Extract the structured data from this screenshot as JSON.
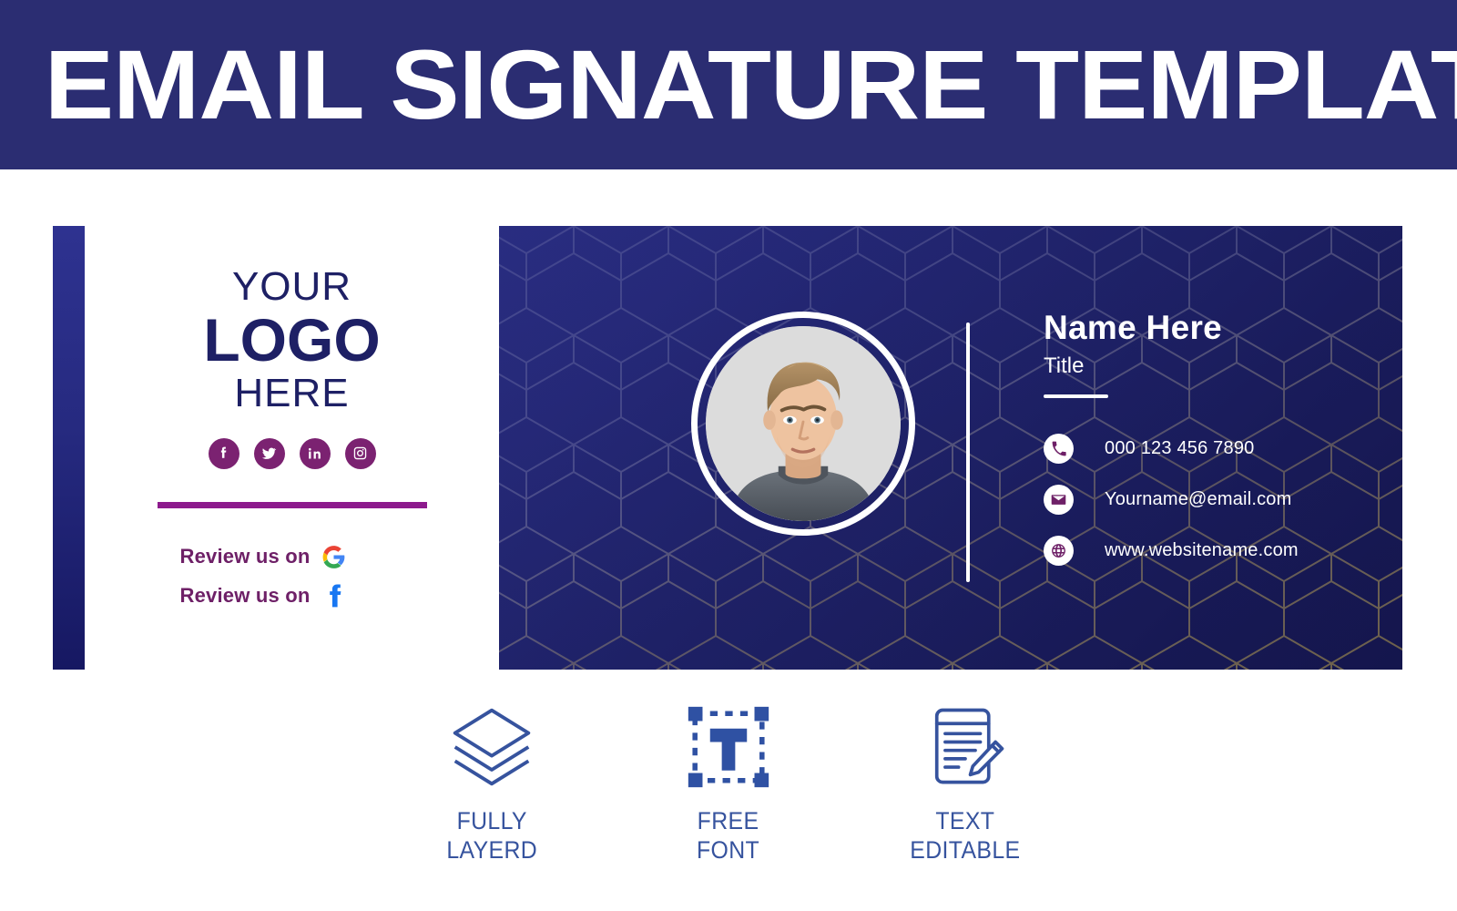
{
  "header": {
    "title": "EMAIL SIGNATURE TEMPLATE",
    "bg_color": "#2b2d72",
    "text_color": "#ffffff"
  },
  "colors": {
    "navy": "#2b2d72",
    "card_navy": "#2a2e86",
    "purple": "#6e2067",
    "purple_rule": "#8d1a8d",
    "feature_blue": "#36539e",
    "logo_navy": "#1e2065"
  },
  "card": {
    "logo_panel": {
      "line1": "YOUR",
      "line2": "LOGO",
      "line3": "HERE",
      "social": [
        {
          "name": "facebook-icon",
          "label": "Facebook"
        },
        {
          "name": "twitter-icon",
          "label": "Twitter"
        },
        {
          "name": "linkedin-icon",
          "label": "LinkedIn"
        },
        {
          "name": "instagram-icon",
          "label": "Instagram"
        }
      ],
      "reviews": [
        {
          "text": "Review us on",
          "icon": "google-icon"
        },
        {
          "text": "Review us on",
          "icon": "facebook-letter-icon"
        }
      ]
    },
    "profile": {
      "avatar": "portrait-photo",
      "name": "Name Here",
      "title": "Title",
      "contacts": [
        {
          "icon": "phone-icon",
          "value": "000 123 456 7890"
        },
        {
          "icon": "envelope-icon",
          "value": "Yourname@email.com"
        },
        {
          "icon": "globe-icon",
          "value": "www.websitename.com"
        }
      ]
    }
  },
  "features": [
    {
      "icon": "layers-icon",
      "label": "FULLY\nLAYERD"
    },
    {
      "icon": "free-font-icon",
      "label": "FREE\nFONT"
    },
    {
      "icon": "text-editable-icon",
      "label": "TEXT\nEDITABLE"
    }
  ]
}
